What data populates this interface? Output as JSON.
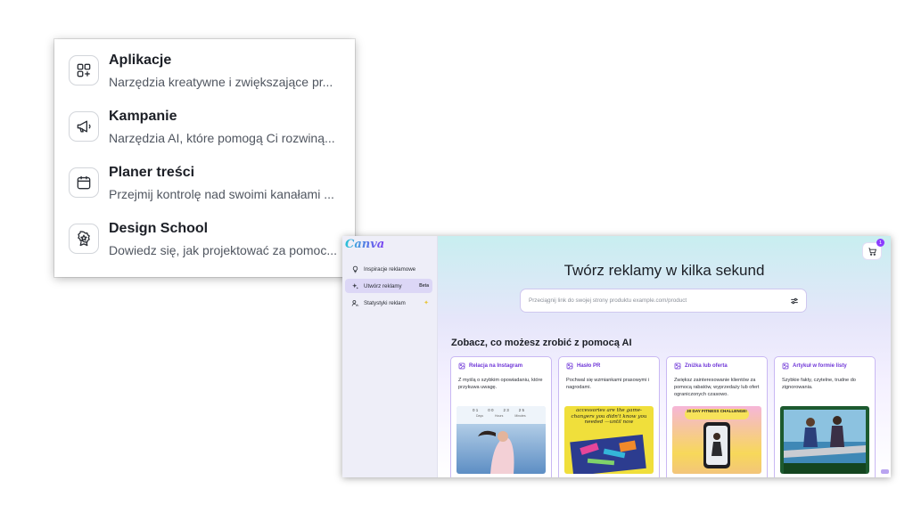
{
  "menu": {
    "items": [
      {
        "title": "Aplikacje",
        "subtitle": "Narzędzia kreatywne i zwiększające pr...",
        "icon": "apps-icon"
      },
      {
        "title": "Kampanie",
        "subtitle": "Narzędzia AI, które pomogą Ci rozwiną...",
        "icon": "megaphone-icon"
      },
      {
        "title": "Planer treści",
        "subtitle": "Przejmij kontrolę nad swoimi kanałami ...",
        "icon": "calendar-icon"
      },
      {
        "title": "Design School",
        "subtitle": "Dowiedz się, jak projektować za pomoc...",
        "icon": "badge-icon"
      }
    ]
  },
  "app": {
    "logo": "Canva",
    "cart_count": "1",
    "sidebar": {
      "items": [
        {
          "label": "Inspiracje reklamowe",
          "icon": "lightbulb-icon",
          "active": false
        },
        {
          "label": "Utwórz reklamy",
          "icon": "sparkle-icon",
          "active": true,
          "tag": "Beta"
        },
        {
          "label": "Statystyki reklam",
          "icon": "user-chart-icon",
          "active": false,
          "tag": "✦"
        }
      ]
    },
    "hero_title": "Twórz reklamy w kilka sekund",
    "search_placeholder": "Przeciągnij link do swojej strony produktu example.com/product",
    "section_title": "Zobacz, co możesz zrobić z pomocą AI",
    "cards": [
      {
        "title": "Relacja na Instagram",
        "desc": "Z myślą o szybkim opowiadaniu, które przykuwa uwagę."
      },
      {
        "title": "Hasło PR",
        "desc": "Pochwal się wzmiankami prasowymi i nagrodami."
      },
      {
        "title": "Zniżka lub oferta",
        "desc": "Zwiększ zainteresowanie klientów za pomocą rabatów, wyprzedaży lub ofert ograniczonych czasowo."
      },
      {
        "title": "Artykuł w formie listy",
        "desc": "Szybkie fakty, czytelne, trudne do zignorowania."
      }
    ],
    "thumbs": {
      "countdown": [
        "0 1",
        "0 0",
        "2 3",
        "2 5"
      ],
      "countdown_labels": [
        "Days",
        "Hours",
        "Minutes"
      ],
      "pr_text": "accessories are the game-changers you didn't know you needed —until now",
      "fitness_text": "30 DAY FITNESS CHALLENGE!"
    },
    "colors": {
      "accent": "#8b3dff",
      "card_border": "#c9b8f3",
      "card_title": "#6f36d8"
    }
  }
}
